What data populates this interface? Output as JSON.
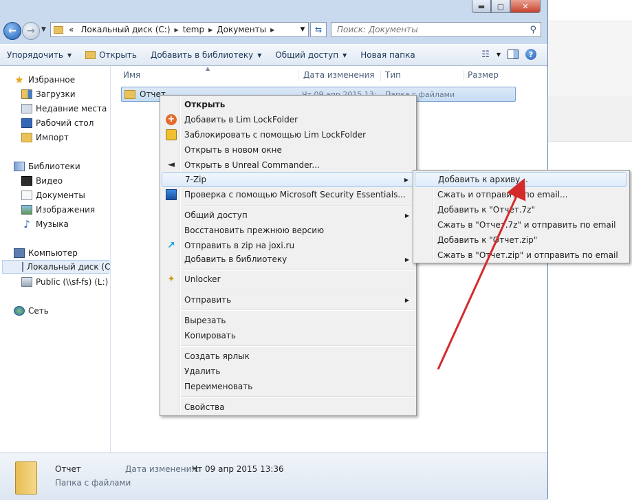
{
  "window": {
    "caps": {
      "minimize": "▬",
      "maximize": "▢",
      "close": "✕"
    }
  },
  "address": {
    "prefix": "«",
    "crumbs": [
      "Локальный диск (C:)",
      "temp",
      "Документы"
    ]
  },
  "search": {
    "placeholder": "Поиск: Документы"
  },
  "toolbar": {
    "organize": "Упорядочить",
    "open": "Открыть",
    "add_library": "Добавить в библиотеку",
    "share": "Общий доступ",
    "new_folder": "Новая папка"
  },
  "nav": {
    "favorites": "Избранное",
    "downloads": "Загрузки",
    "recent": "Недавние места",
    "desktop": "Рабочий стол",
    "import": "Импорт",
    "libraries": "Библиотеки",
    "video": "Видео",
    "documents": "Документы",
    "images": "Изображения",
    "music": "Музыка",
    "computer": "Компьютер",
    "local_disk": "Локальный диск (C",
    "public": "Public (\\\\sf-fs) (L:)",
    "network": "Сеть"
  },
  "columns": {
    "name": "Имя",
    "date": "Дата изменения",
    "type": "Тип",
    "size": "Размер"
  },
  "file": {
    "name": "Отчет",
    "date": "Чт 09 апр 2015 13:",
    "type": "Папка с файлами"
  },
  "context_menu": {
    "open": "Открыть",
    "lim_add": "Добавить в Lim LockFolder",
    "lim_lock": "Заблокировать с помощью Lim LockFolder",
    "open_new_window": "Открыть в новом окне",
    "unreal": "Открыть в Unreal Commander...",
    "sevenzip": "7-Zip",
    "mse": "Проверка с помощью Microsoft Security Essentials...",
    "share": "Общий доступ",
    "restore": "Восстановить прежнюю версию",
    "joxi": "Отправить в zip на joxi.ru",
    "add_library": "Добавить в библиотеку",
    "unlocker": "Unlocker",
    "send_to": "Отправить",
    "cut": "Вырезать",
    "copy": "Копировать",
    "shortcut": "Создать ярлык",
    "delete": "Удалить",
    "rename": "Переименовать",
    "properties": "Свойства"
  },
  "submenu": {
    "add_archive": "Добавить к архиву...",
    "compress_email": "Сжать и отправить по email...",
    "add_7z": "Добавить к \"Отчет.7z\"",
    "compress_7z_email": "Сжать в \"Отчет.7z\" и отправить по email",
    "add_zip": "Добавить к \"Отчет.zip\"",
    "compress_zip_email": "Сжать в \"Отчет.zip\" и отправить по email"
  },
  "details": {
    "name": "Отчет",
    "type": "Папка с файлами",
    "date_label": "Дата изменения:",
    "date_value": "Чт 09 апр 2015 13:36"
  },
  "colors": {
    "arrow": "#d42a2a",
    "selection": "#c4dcf3",
    "menu_bg": "#f0f0f0"
  }
}
